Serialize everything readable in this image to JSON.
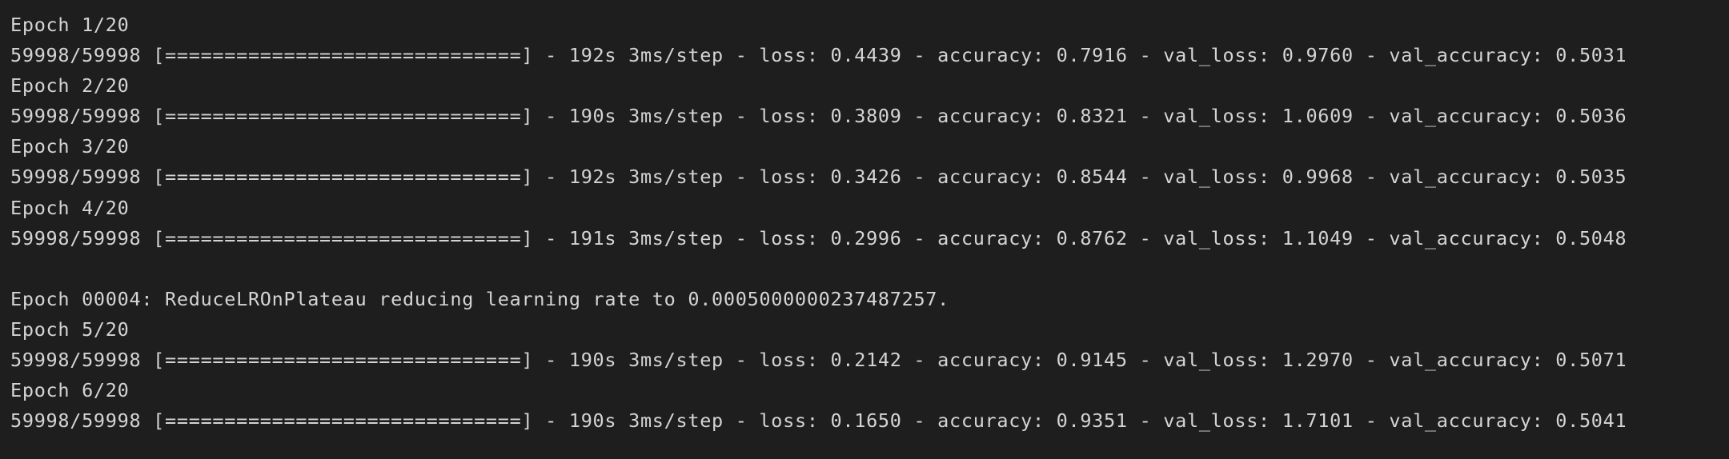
{
  "colors": {
    "background": "#1e1e1e",
    "text": "#d4d4d4"
  },
  "output": {
    "lines": [
      "Epoch 1/20",
      "59998/59998 [==============================] - 192s 3ms/step - loss: 0.4439 - accuracy: 0.7916 - val_loss: 0.9760 - val_accuracy: 0.5031",
      "Epoch 2/20",
      "59998/59998 [==============================] - 190s 3ms/step - loss: 0.3809 - accuracy: 0.8321 - val_loss: 1.0609 - val_accuracy: 0.5036",
      "Epoch 3/20",
      "59998/59998 [==============================] - 192s 3ms/step - loss: 0.3426 - accuracy: 0.8544 - val_loss: 0.9968 - val_accuracy: 0.5035",
      "Epoch 4/20",
      "59998/59998 [==============================] - 191s 3ms/step - loss: 0.2996 - accuracy: 0.8762 - val_loss: 1.1049 - val_accuracy: 0.5048",
      "",
      "Epoch 00004: ReduceLROnPlateau reducing learning rate to 0.0005000000237487257.",
      "Epoch 5/20",
      "59998/59998 [==============================] - 190s 3ms/step - loss: 0.2142 - accuracy: 0.9145 - val_loss: 1.2970 - val_accuracy: 0.5071",
      "Epoch 6/20",
      "59998/59998 [==============================] - 190s 3ms/step - loss: 0.1650 - accuracy: 0.9351 - val_loss: 1.7101 - val_accuracy: 0.5041"
    ]
  }
}
